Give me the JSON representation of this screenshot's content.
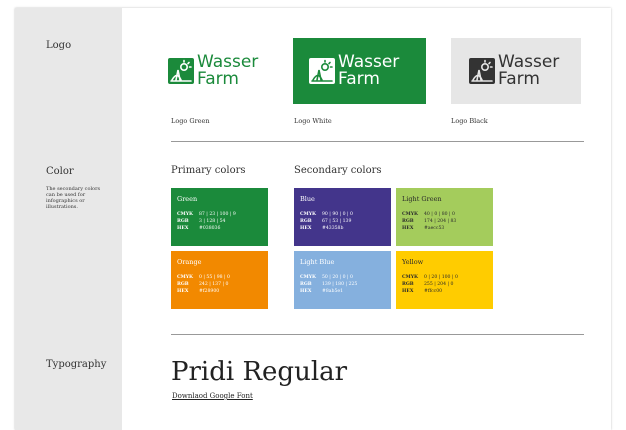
{
  "sections": {
    "logo": "Logo",
    "color": "Color",
    "typography": "Typography"
  },
  "color_note": "The secondary colors can be used for infographics or illustrations.",
  "logos": [
    {
      "line1": "Wasser",
      "line2": "Farm",
      "caption": "Logo Green",
      "variant": "green"
    },
    {
      "line1": "Wasser",
      "line2": "Farm",
      "caption": "Logo White",
      "variant": "white"
    },
    {
      "line1": "Wasser",
      "line2": "Farm",
      "caption": "Logo Black",
      "variant": "black"
    }
  ],
  "primary_heading": "Primary colors",
  "secondary_heading": "Secondary colors",
  "labels": {
    "cmyk": "CMYK",
    "rgb": "RGB",
    "hex": "HEX"
  },
  "swatches": [
    {
      "name": "Green",
      "cmyk": "87 | 23 | 100 | 9",
      "rgb": "3 | 128 | 54",
      "hex": "#038036",
      "color": "#1b8a3b",
      "text": "#ffffff"
    },
    {
      "name": "Blue",
      "cmyk": "90 | 90 | 0 | 0",
      "rgb": "67 | 53 | 139",
      "hex": "#43358b",
      "color": "#43358b",
      "text": "#ffffff"
    },
    {
      "name": "Light Green",
      "cmyk": "40 | 0 | 80 | 0",
      "rgb": "174 | 204 | 83",
      "hex": "#aecc53",
      "color": "#a4cc5c",
      "text": "#2a2a2a"
    },
    {
      "name": "Orange",
      "cmyk": "0 | 55 | 98 | 0",
      "rgb": "242 | 137 | 0",
      "hex": "#f28900",
      "color": "#f28900",
      "text": "#ffffff"
    },
    {
      "name": "Light Blue",
      "cmyk": "50 | 20 | 0 | 0",
      "rgb": "139 | 180 | 225",
      "hex": "#8ab5e1",
      "color": "#85b0de",
      "text": "#ffffff"
    },
    {
      "name": "Yellow",
      "cmyk": "0 | 20 | 100 | 0",
      "rgb": "255 | 204 | 0",
      "hex": "#ffcc00",
      "color": "#ffcc00",
      "text": "#2a2a2a"
    }
  ],
  "typeface": "Pridi Regular",
  "font_link": "Downlaod Google Font",
  "brand_colors": {
    "green": "#1b8a3b",
    "logo_gray": "#e6e6e6",
    "ink": "#333333"
  }
}
